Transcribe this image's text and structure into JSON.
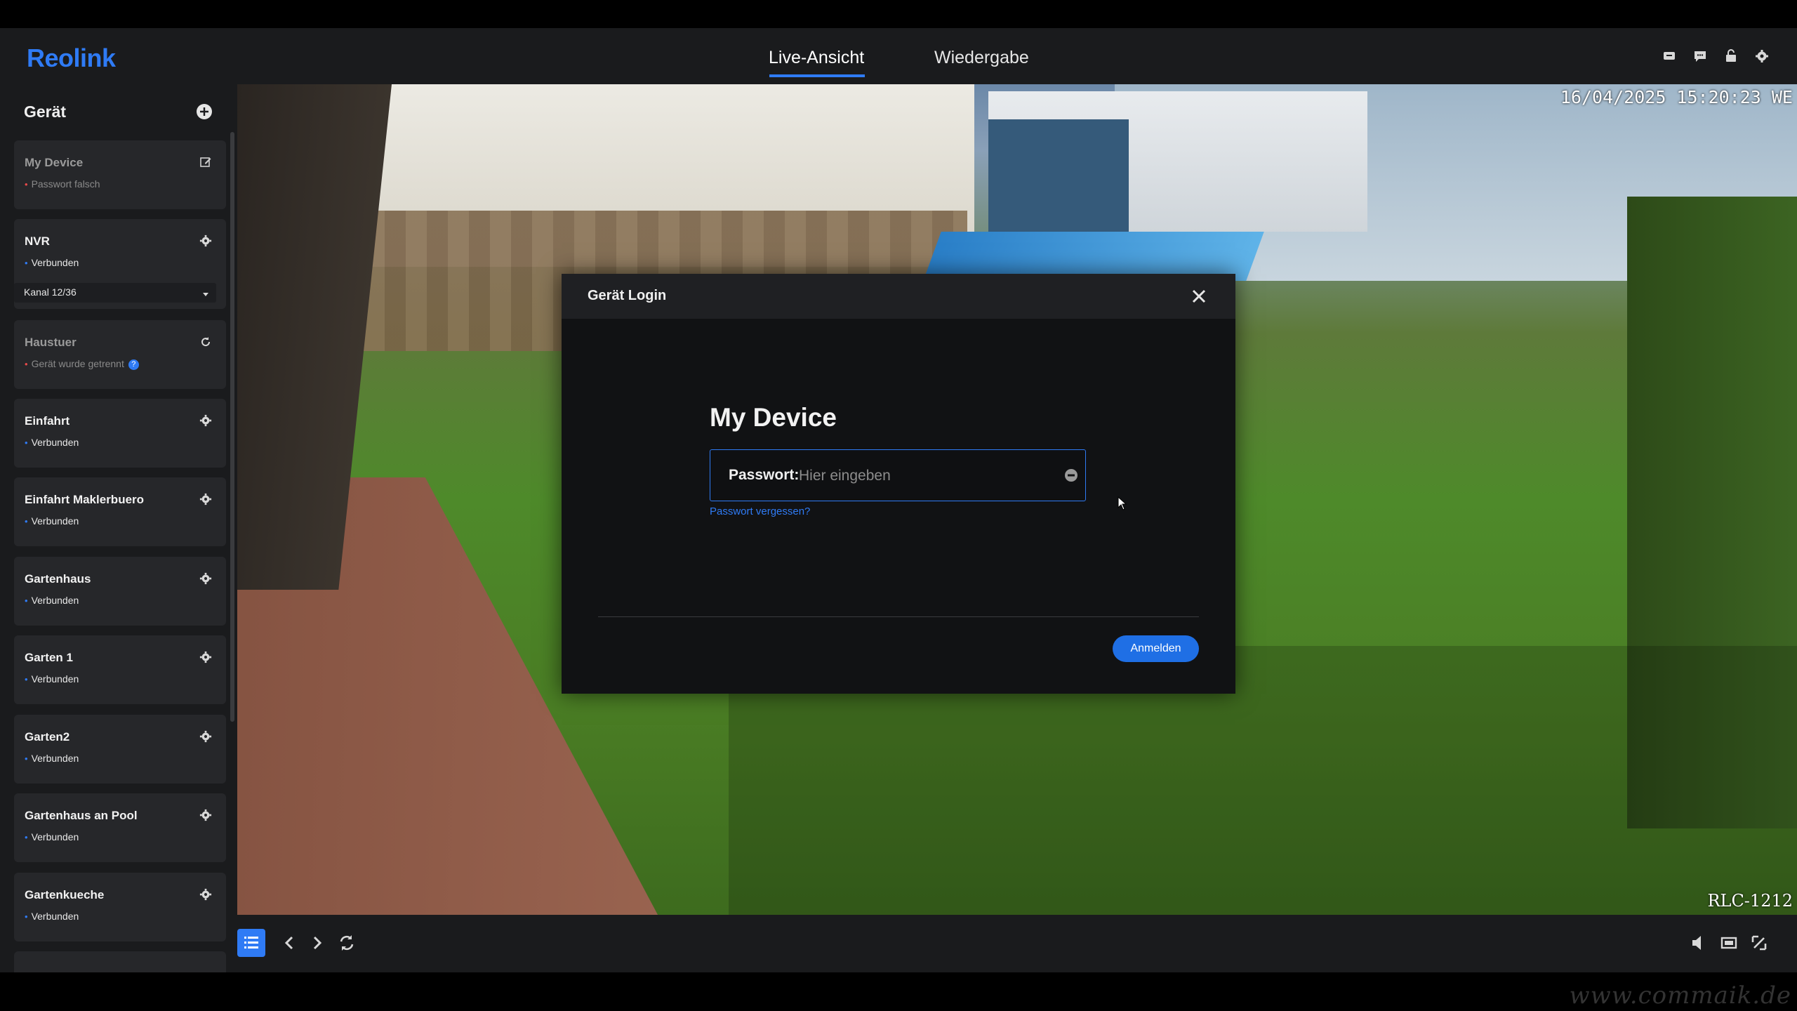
{
  "app": {
    "logo": "Reolink"
  },
  "header": {
    "tabs": [
      {
        "label": "Live-Ansicht",
        "active": true
      },
      {
        "label": "Wiedergabe",
        "active": false
      }
    ],
    "icons": [
      "cloud-icon",
      "chat-icon",
      "notification-icon",
      "settings-icon"
    ]
  },
  "sidebar": {
    "title": "Gerät",
    "devices": [
      {
        "name": "My Device",
        "status": "Passwort falsch",
        "state": "error",
        "icon": "edit-icon"
      },
      {
        "name": "NVR",
        "status": "Verbunden",
        "state": "ok",
        "icon": "gear-icon",
        "channel": "Kanal 12/36"
      },
      {
        "name": "Haustuer",
        "status": "Gerät wurde getrennt",
        "state": "error",
        "icon": "refresh-icon"
      },
      {
        "name": "Einfahrt",
        "status": "Verbunden",
        "state": "ok",
        "icon": "gear-icon"
      },
      {
        "name": "Einfahrt Maklerbuero",
        "status": "Verbunden",
        "state": "ok",
        "icon": "gear-icon"
      },
      {
        "name": "Gartenhaus",
        "status": "Verbunden",
        "state": "ok",
        "icon": "gear-icon"
      },
      {
        "name": "Garten 1",
        "status": "Verbunden",
        "state": "ok",
        "icon": "gear-icon"
      },
      {
        "name": "Garten2",
        "status": "Verbunden",
        "state": "ok",
        "icon": "gear-icon"
      },
      {
        "name": "Gartenhaus an Pool",
        "status": "Verbunden",
        "state": "ok",
        "icon": "gear-icon"
      },
      {
        "name": "Gartenkueche",
        "status": "Verbunden",
        "state": "ok",
        "icon": "gear-icon"
      }
    ]
  },
  "video": {
    "timestamp": "16/04/2025 15:20:23 WE",
    "model": "RLC-1212"
  },
  "dialog": {
    "title": "Gerät Login",
    "device_name": "My Device",
    "password_label": "Passwort:",
    "password_placeholder": "Hier eingeben",
    "forgot_link": "Passwort vergessen?",
    "submit_label": "Anmelden"
  },
  "watermark": "www.commaik.de",
  "colors": {
    "accent": "#2f7bf5",
    "error": "#e84a4a",
    "panel": "#1a1b1d",
    "card": "#26272a"
  }
}
